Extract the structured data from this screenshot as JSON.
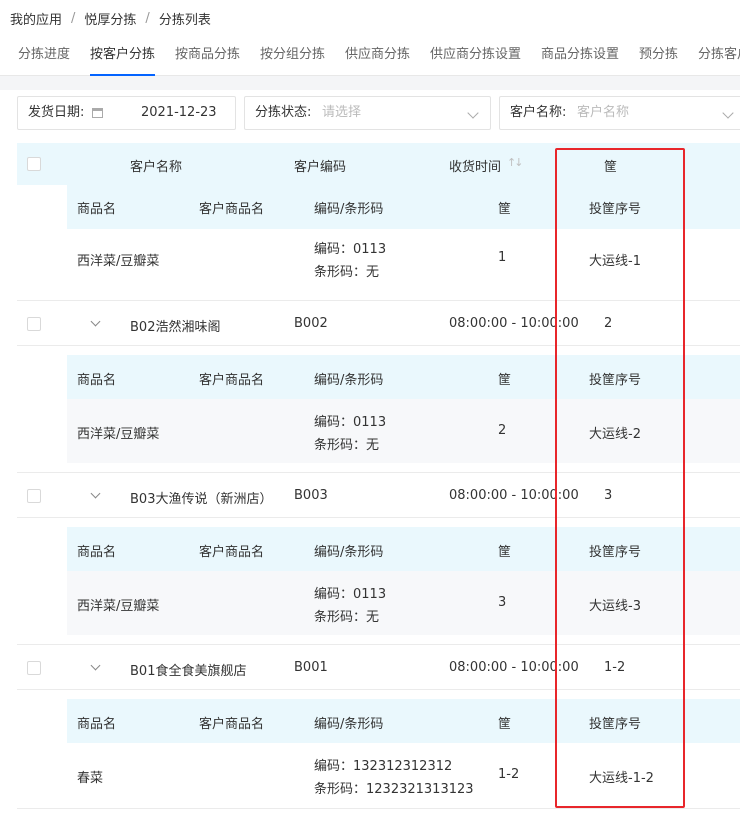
{
  "breadcrumb": [
    "我的应用",
    "悦厚分拣",
    "分拣列表"
  ],
  "tabs": [
    "分拣进度",
    "按客户分拣",
    "按商品分拣",
    "按分组分拣",
    "供应商分拣",
    "供应商分拣设置",
    "商品分拣设置",
    "预分拣",
    "分拣客户"
  ],
  "active_tab_index": 1,
  "filters": {
    "date_label": "发货日期:",
    "date_value": "2021-12-23",
    "status_label": "分拣状态:",
    "status_placeholder": "请选择",
    "customer_label": "客户名称:",
    "customer_placeholder": "客户名称"
  },
  "table_header": {
    "customer_name": "客户名称",
    "customer_code": "客户编码",
    "receive_time": "收货时间",
    "basket": "筐"
  },
  "sub_header": {
    "product_name": "商品名",
    "customer_product_name": "客户商品名",
    "code_barcode": "编码/条形码",
    "basket": "筐",
    "basket_seq": "投筐序号"
  },
  "groups": [
    {
      "show_summary": false,
      "customer": "",
      "code": "",
      "time": "",
      "basket": "",
      "item": {
        "product": "西洋菜/豆瓣菜",
        "customer_product": "",
        "code_line": "编码：0113",
        "barcode_line": "条形码：无",
        "basket": "1",
        "seq": "大运线-1"
      }
    },
    {
      "show_summary": true,
      "customer": "B02浩然湘味阁",
      "code": "B002",
      "time": "08:00:00 - 10:00:00",
      "basket": "2",
      "item": {
        "product": "西洋菜/豆瓣菜",
        "customer_product": "",
        "code_line": "编码：0113",
        "barcode_line": "条形码：无",
        "basket": "2",
        "seq": "大运线-2"
      }
    },
    {
      "show_summary": true,
      "customer": "B03大渔传说（新洲店）",
      "code": "B003",
      "time": "08:00:00 - 10:00:00",
      "basket": "3",
      "item": {
        "product": "西洋菜/豆瓣菜",
        "customer_product": "",
        "code_line": "编码：0113",
        "barcode_line": "条形码：无",
        "basket": "3",
        "seq": "大运线-3"
      }
    },
    {
      "show_summary": true,
      "customer": "B01食全食美旗舰店",
      "code": "B001",
      "time": "08:00:00 - 10:00:00",
      "basket": "1-2",
      "item": {
        "product": "春菜",
        "customer_product": "",
        "code_line": "编码：132312312312",
        "barcode_line": "条形码：1232321313123",
        "basket": "1-2",
        "seq": "大运线-1-2"
      }
    }
  ],
  "colors": {
    "accent": "#0363ff",
    "header_bg": "#eaf8fd",
    "highlight_border": "#e8262b"
  }
}
